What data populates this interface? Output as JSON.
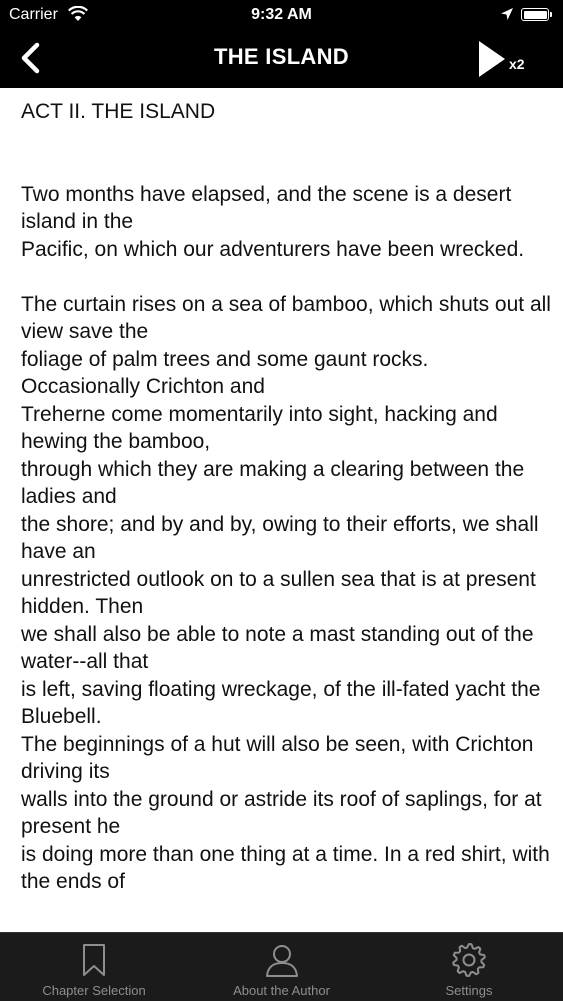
{
  "status_bar": {
    "carrier": "Carrier",
    "time": "9:32 AM",
    "battery_percent": 100
  },
  "nav_bar": {
    "title": "THE ISLAND",
    "playback_speed": "x2"
  },
  "content": {
    "heading": "ACT II. THE ISLAND",
    "paragraphs": [
      "Two months have elapsed, and the scene is a desert island in the\nPacific, on which our adventurers have been wrecked.",
      "The curtain rises on a sea of bamboo, which shuts out all view save the\nfoliage of palm trees and some gaunt rocks. Occasionally Crichton and\nTreherne come momentarily into sight, hacking and hewing the bamboo,\nthrough which they are making a clearing between the ladies and\nthe shore; and by and by, owing to their efforts, we shall have an\nunrestricted outlook on to a sullen sea that is at present hidden. Then\nwe shall also be able to note a mast standing out of the water--all that\nis left, saving floating wreckage, of the ill-fated yacht the Bluebell.\nThe beginnings of a hut will also be seen, with Crichton driving its\nwalls into the ground or astride its roof of saplings, for at present he\nis doing more than one thing at a time. In a red shirt, with the ends of"
    ]
  },
  "tab_bar": {
    "tabs": [
      {
        "label": "Chapter Selection",
        "icon": "bookmark-icon"
      },
      {
        "label": "About the Author",
        "icon": "person-icon"
      },
      {
        "label": "Settings",
        "icon": "gear-icon"
      }
    ]
  }
}
